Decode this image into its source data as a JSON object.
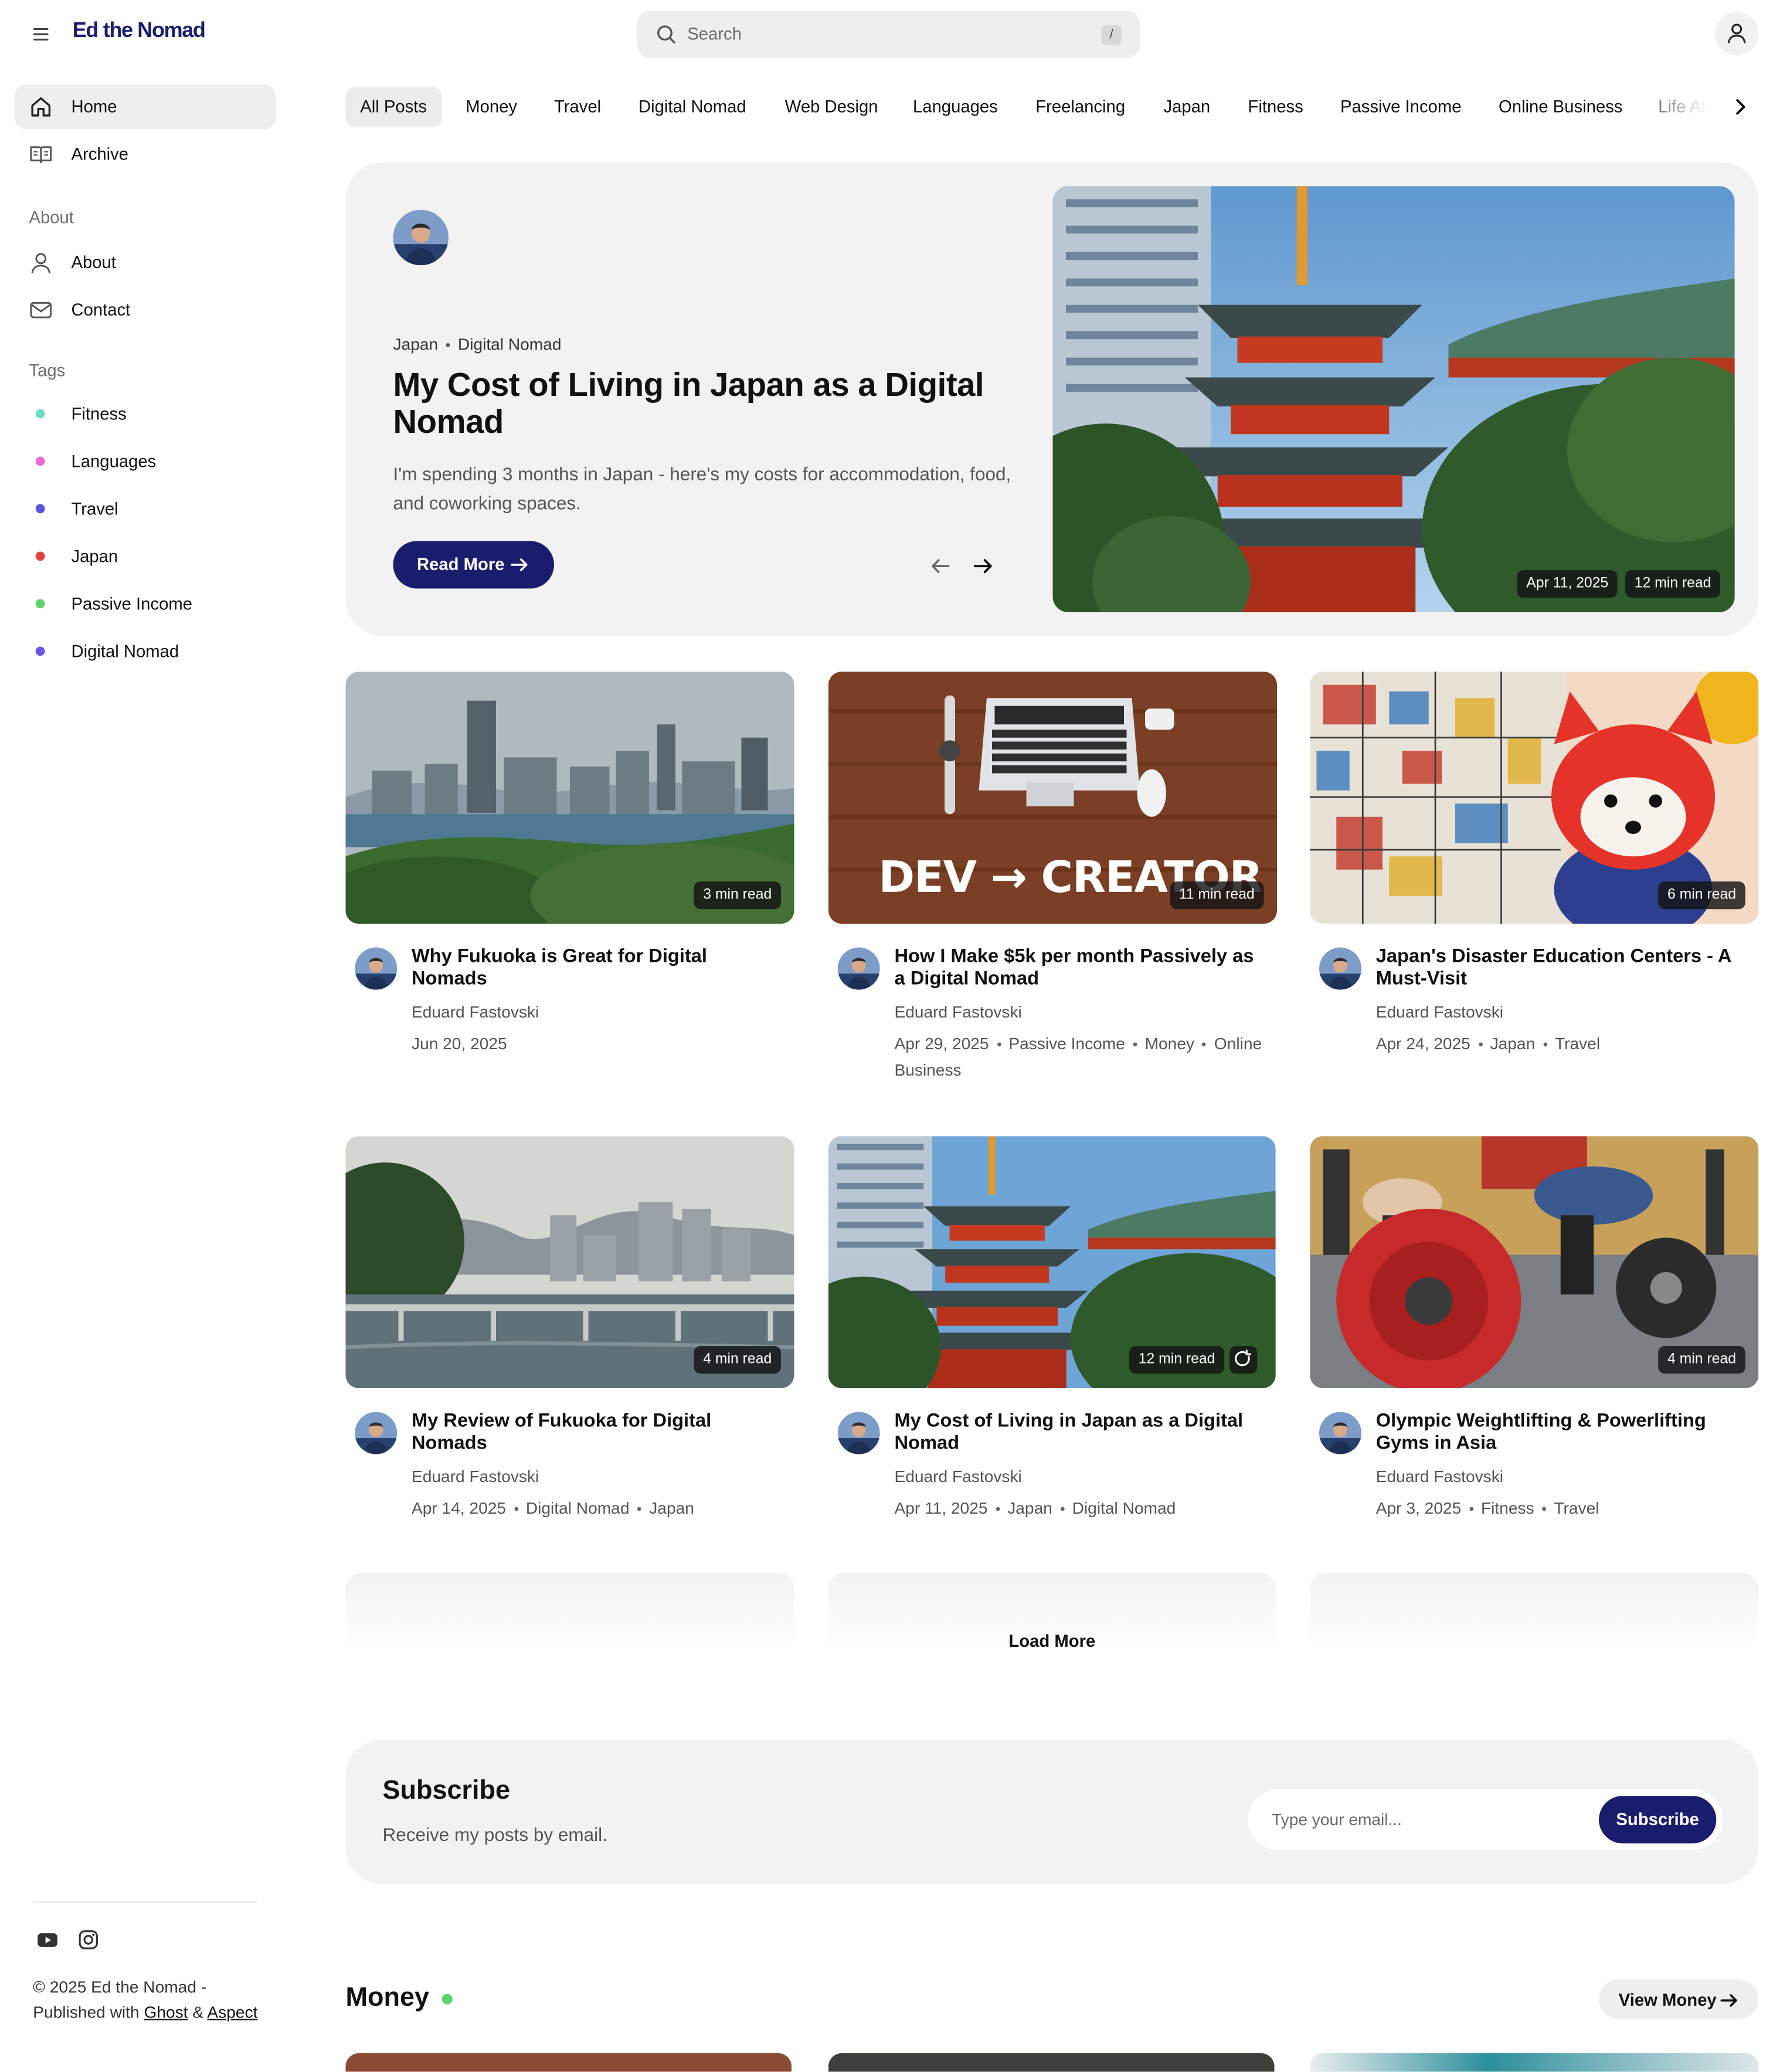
{
  "header": {
    "logo": "Ed the Nomad",
    "search_placeholder": "Search",
    "search_shortcut": "/"
  },
  "sidebar": {
    "nav": [
      {
        "label": "Home",
        "icon": "home-icon",
        "active": true
      },
      {
        "label": "Archive",
        "icon": "book-icon",
        "active": false
      }
    ],
    "about_heading": "About",
    "about_items": [
      {
        "label": "About",
        "icon": "user-icon"
      },
      {
        "label": "Contact",
        "icon": "mail-icon"
      }
    ],
    "tags_heading": "Tags",
    "tags": [
      {
        "label": "Fitness",
        "color": "#6fdcc8"
      },
      {
        "label": "Languages",
        "color": "#ef6ad6"
      },
      {
        "label": "Travel",
        "color": "#5a4fe0"
      },
      {
        "label": "Japan",
        "color": "#e3423c"
      },
      {
        "label": "Passive Income",
        "color": "#5dd36b"
      },
      {
        "label": "Digital Nomad",
        "color": "#6a55e8"
      }
    ],
    "socials": [
      "youtube-icon",
      "instagram-icon"
    ],
    "footer": {
      "copyright_prefix": "© 2025 Ed the Nomad - Published with",
      "ghost": "Ghost",
      "amp": "&",
      "aspect": "Aspect"
    }
  },
  "tag_chips": [
    "All Posts",
    "Money",
    "Travel",
    "Digital Nomad",
    "Web Design",
    "Languages",
    "Freelancing",
    "Japan",
    "Fitness",
    "Passive Income",
    "Online Business",
    "Life Abroad"
  ],
  "hero": {
    "tags": [
      "Japan",
      "Digital Nomad"
    ],
    "title": "My Cost of Living in Japan as a Digital Nomad",
    "excerpt": "I'm spending 3 months in Japan - here's my costs for accommodation, food, and coworking spaces.",
    "button": "Read More",
    "date": "Apr 11, 2025",
    "read_time": "12 min read"
  },
  "posts": [
    {
      "title": "Why Fukuoka is Great for Digital Nomads",
      "author": "Eduard Fastovski",
      "date": "Jun 20, 2025",
      "tags": [],
      "read_time": "3 min read"
    },
    {
      "title": "How I Make $5k per month Passively as a Digital Nomad",
      "author": "Eduard Fastovski",
      "date": "Apr 29, 2025",
      "tags": [
        "Passive Income",
        "Money",
        "Online Business"
      ],
      "read_time": "11 min read",
      "image_text": "DEV → CREATOR"
    },
    {
      "title": "Japan's Disaster Education Centers - A Must-Visit",
      "author": "Eduard Fastovski",
      "date": "Apr 24, 2025",
      "tags": [
        "Japan",
        "Travel"
      ],
      "read_time": "6 min read"
    },
    {
      "title": "My Review of Fukuoka for Digital Nomads",
      "author": "Eduard Fastovski",
      "date": "Apr 14, 2025",
      "tags": [
        "Digital Nomad",
        "Japan"
      ],
      "read_time": "4 min read"
    },
    {
      "title": "My Cost of Living in Japan as a Digital Nomad",
      "author": "Eduard Fastovski",
      "date": "Apr 11, 2025",
      "tags": [
        "Japan",
        "Digital Nomad"
      ],
      "read_time": "12 min read"
    },
    {
      "title": "Olympic Weightlifting & Powerlifting Gyms in Asia",
      "author": "Eduard Fastovski",
      "date": "Apr 3, 2025",
      "tags": [
        "Fitness",
        "Travel"
      ],
      "read_time": "4 min read"
    }
  ],
  "load_more": "Load More",
  "subscribe": {
    "title": "Subscribe",
    "text": "Receive my posts by email.",
    "placeholder": "Type your email...",
    "button": "Subscribe"
  },
  "money_section": {
    "title": "Money",
    "dot_color": "#5dd36b",
    "button": "View Money"
  },
  "colors": {
    "brand": "#1a1d6e",
    "panel": "#f2f2f2"
  }
}
